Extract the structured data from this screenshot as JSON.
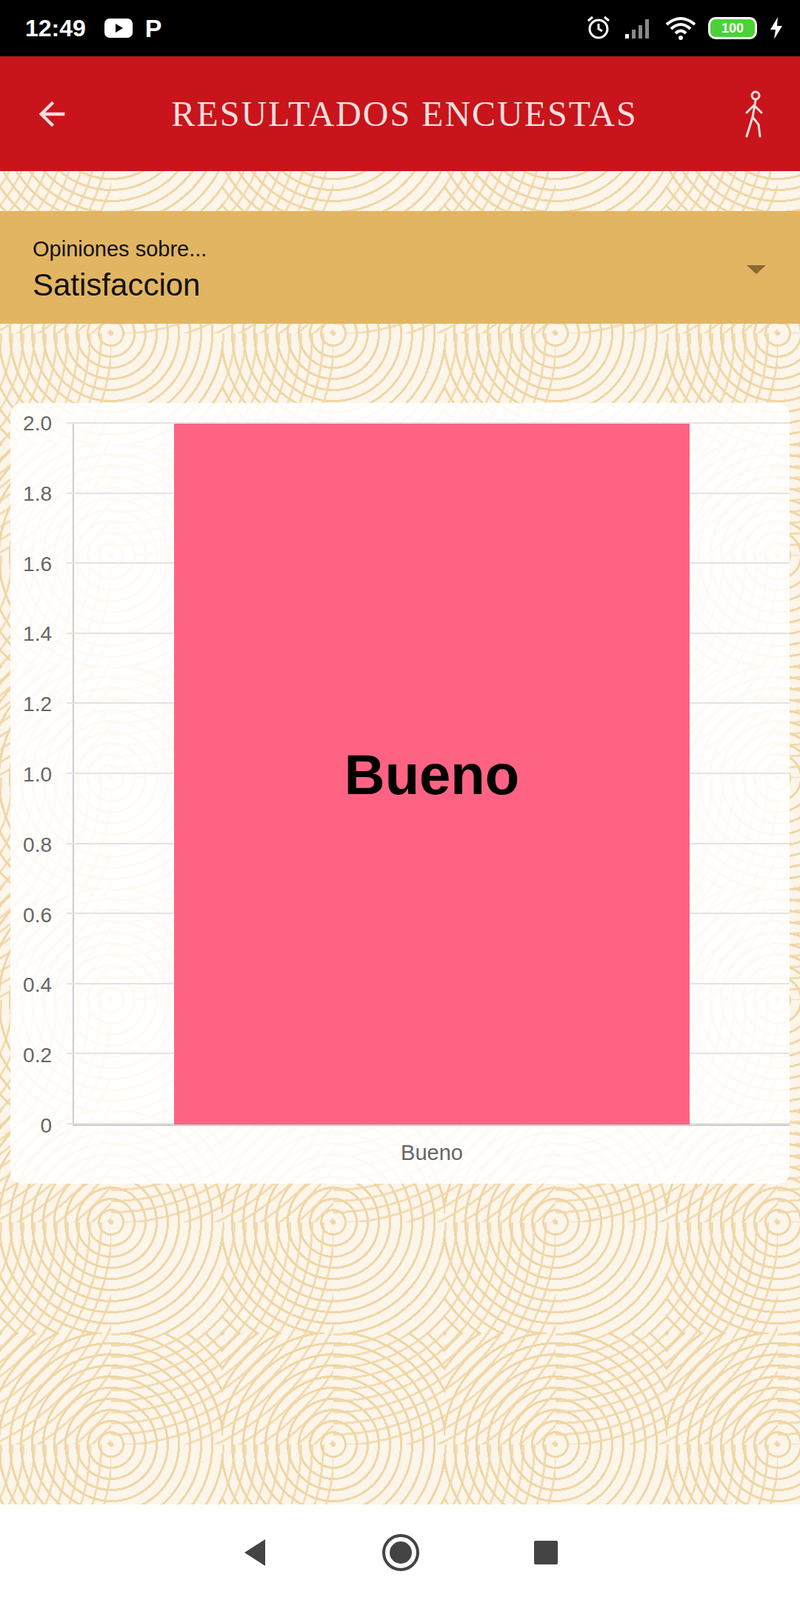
{
  "status_bar": {
    "time": "12:49",
    "notification_glyph": "P",
    "battery": "100"
  },
  "app_bar": {
    "title": "RESULTADOS ENCUESTAS"
  },
  "selector": {
    "label": "Opiniones sobre...",
    "value": "Satisfaccion"
  },
  "chart": {
    "y_max": 2,
    "y_ticks": [
      "2.0",
      "1.8",
      "1.6",
      "1.4",
      "1.2",
      "1.0",
      "0.8",
      "0.6",
      "0.4",
      "0.2",
      "0"
    ],
    "categories": [
      "Bueno"
    ],
    "series": [
      {
        "values": [
          2
        ],
        "data_labels": [
          "Bueno"
        ]
      }
    ]
  }
}
